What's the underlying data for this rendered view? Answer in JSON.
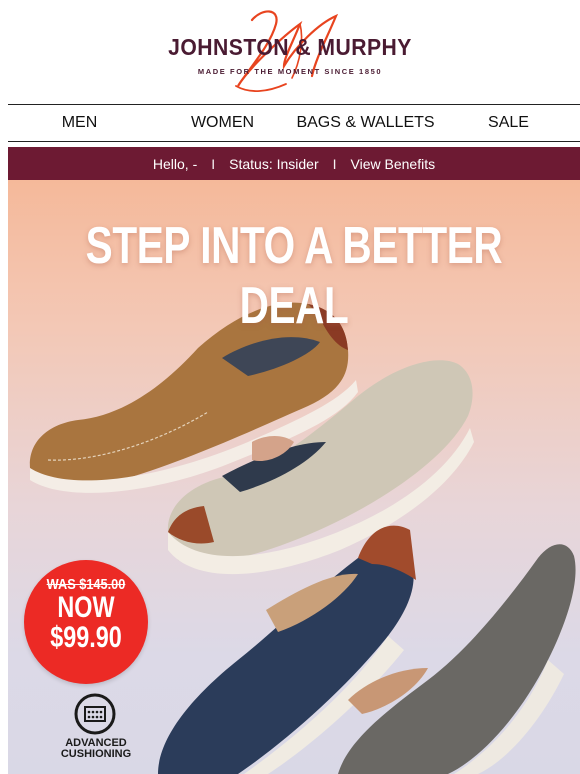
{
  "header": {
    "brand": "JOHNSTON & MURPHY",
    "tagline": "MADE FOR THE MOMENT SINCE 1850",
    "brand_color": "#4a1b32",
    "monogram_color": "#e8441f"
  },
  "nav": {
    "items": [
      {
        "label": "MEN"
      },
      {
        "label": "WOMEN"
      },
      {
        "label": "BAGS & WALLETS"
      },
      {
        "label": "SALE"
      }
    ]
  },
  "member_bar": {
    "greeting": "Hello, -",
    "separator": "I",
    "status": "Status: Insider",
    "benefits_link": "View Benefits",
    "background": "#6d1a33"
  },
  "hero": {
    "headline": "STEP INTO A BETTER DEAL",
    "price_badge": {
      "was": "WAS $145.00",
      "now": "NOW",
      "amount": "$99.90",
      "color": "#ec2a25"
    },
    "feature": {
      "icon": "cushion-icon",
      "label_line1": "ADVANCED",
      "label_line2": "CUSHIONING"
    }
  }
}
